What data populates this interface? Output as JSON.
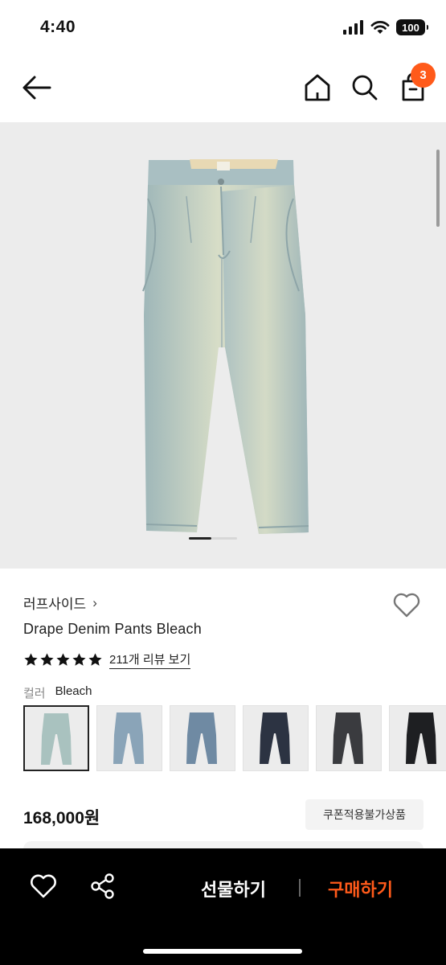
{
  "status_bar": {
    "time": "4:40",
    "battery": "100"
  },
  "nav": {
    "cart_count": "3"
  },
  "product": {
    "brand": "러프사이드",
    "brand_chevron": "›",
    "name": "Drape Denim Pants Bleach",
    "rating_stars": 5,
    "review_link": "211개 리뷰 보기",
    "color_label": "컬러",
    "color_value": "Bleach",
    "price": "168,000원",
    "coupon_badge": "쿠폰적용불가상품"
  },
  "swatches": [
    {
      "name": "Bleach",
      "tone": "#a9c2bf",
      "selected": true
    },
    {
      "name": "light-blue",
      "tone": "#8aa4b8",
      "selected": false
    },
    {
      "name": "mid-blue",
      "tone": "#6f8aa3",
      "selected": false
    },
    {
      "name": "navy",
      "tone": "#2c3342",
      "selected": false
    },
    {
      "name": "black-wash",
      "tone": "#3a3b3f",
      "selected": false
    },
    {
      "name": "black",
      "tone": "#1e1f22",
      "selected": false
    }
  ],
  "bottom_bar": {
    "gift_label": "선물하기",
    "buy_label": "구매하기"
  },
  "colors": {
    "accent": "#ff5a1a",
    "bar_bg": "#000000",
    "image_bg": "#ececec"
  }
}
